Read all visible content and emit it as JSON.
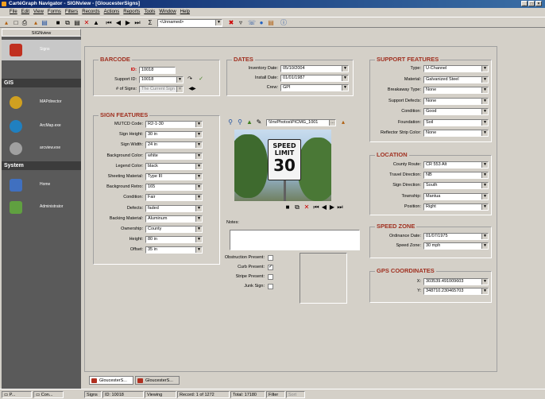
{
  "window": {
    "title": "CartéGraph Navigator - SIGNview - [GloucesterSigns]",
    "controls": [
      "_",
      "□",
      "×"
    ]
  },
  "menu": [
    "File",
    "Edit",
    "View",
    "Forms",
    "Filters",
    "Records",
    "Actions",
    "Reports",
    "Tools",
    "Window",
    "Help"
  ],
  "toolbar": {
    "view_select": "<Unnamed>"
  },
  "sidebar": {
    "title": "SIGNview",
    "sections": [
      {
        "label": "GIS"
      },
      {
        "label": "System"
      }
    ],
    "items": [
      {
        "label": "Signs"
      },
      {
        "label": "MAPdirector"
      },
      {
        "label": "ArcMap.exe"
      },
      {
        "label": "arcview.exe"
      },
      {
        "label": "Home"
      },
      {
        "label": "Administrator"
      }
    ]
  },
  "barcode": {
    "title": "BARCODE",
    "id_label": "ID:",
    "id_value": "10018",
    "support_label": "Support ID:",
    "support_value": "10018",
    "signs_label": "# of Signs:",
    "signs_value": "The Current Sign"
  },
  "dates": {
    "title": "DATES",
    "inv_label": "Inventory Date:",
    "inv_value": "05/10/2004",
    "install_label": "Install Date:",
    "install_value": "01/01/1987",
    "crew_label": "Crew:",
    "crew_value": "GPI"
  },
  "sign_features": {
    "title": "SIGN FEATURES",
    "fields": [
      {
        "label": "MUTCD Code:",
        "value": "R2-1-30"
      },
      {
        "label": "Sign Height:",
        "value": "30 in"
      },
      {
        "label": "Sign Width:",
        "value": "24 in"
      },
      {
        "label": "Background Color:",
        "value": "white"
      },
      {
        "label": "Legend Color:",
        "value": "black"
      },
      {
        "label": "Sheeting Material:",
        "value": "Type III"
      },
      {
        "label": "Background Retro:",
        "value": "165"
      },
      {
        "label": "Condition:",
        "value": "Fair"
      },
      {
        "label": "Defects:",
        "value": "faded"
      },
      {
        "label": "Backing Material:",
        "value": "Aluminum"
      },
      {
        "label": "Ownership:",
        "value": "County"
      },
      {
        "label": "Height:",
        "value": "80 in"
      },
      {
        "label": "Offset:",
        "value": "35 in"
      }
    ]
  },
  "photo": {
    "path": "\\\\InvPhotos\\PICMG_1001",
    "sign_line1": "SPEED",
    "sign_line2": "LIMIT",
    "sign_number": "30",
    "notes_label": "Notes:"
  },
  "checks": [
    {
      "label": "Obstruction Present:",
      "checked": false
    },
    {
      "label": "Curb Present:",
      "checked": true
    },
    {
      "label": "Stripe Present:",
      "checked": false
    },
    {
      "label": "Junk Sign:",
      "checked": false
    }
  ],
  "support_features": {
    "title": "SUPPORT FEATURES",
    "fields": [
      {
        "label": "Type:",
        "value": "U-Channel"
      },
      {
        "label": "Material:",
        "value": "Galvanized Steel"
      },
      {
        "label": "Breakaway Type:",
        "value": "None"
      },
      {
        "label": "Support Defects:",
        "value": "None"
      },
      {
        "label": "Condition:",
        "value": "Good"
      },
      {
        "label": "Foundation:",
        "value": "Soil"
      },
      {
        "label": "Reflector Strip Color:",
        "value": "None"
      }
    ]
  },
  "location": {
    "title": "LOCATION",
    "fields": [
      {
        "label": "County Route:",
        "value": "CR 553 Alt"
      },
      {
        "label": "Travel Direction:",
        "value": "NB"
      },
      {
        "label": "Sign Direction:",
        "value": "South"
      },
      {
        "label": "Township:",
        "value": "Mantua"
      },
      {
        "label": "Position:",
        "value": "Right"
      }
    ]
  },
  "speed_zone": {
    "title": "SPEED ZONE",
    "fields": [
      {
        "label": "Ordinance Date:",
        "value": "01/07/1975"
      },
      {
        "label": "Speed Zone:",
        "value": "30 mph"
      }
    ]
  },
  "gps": {
    "title": "GPS COORDINATES",
    "fields": [
      {
        "label": "X:",
        "value": "303539.491009603"
      },
      {
        "label": "Y:",
        "value": "348710.230465703"
      }
    ]
  },
  "tabs": [
    "GloucesterS...",
    "GloucesterS..."
  ],
  "status": {
    "taskbar1": "P...",
    "taskbar2": "Con...",
    "form": "Signs",
    "id": "ID: 10018",
    "mode": "Viewing",
    "record": "Record: 1 of 1272",
    "total": "Total: 17180",
    "filter": "Filter",
    "sort": "Sort"
  },
  "colors": {
    "accent": "#a03020",
    "sidebar": "#5a5a5a"
  }
}
